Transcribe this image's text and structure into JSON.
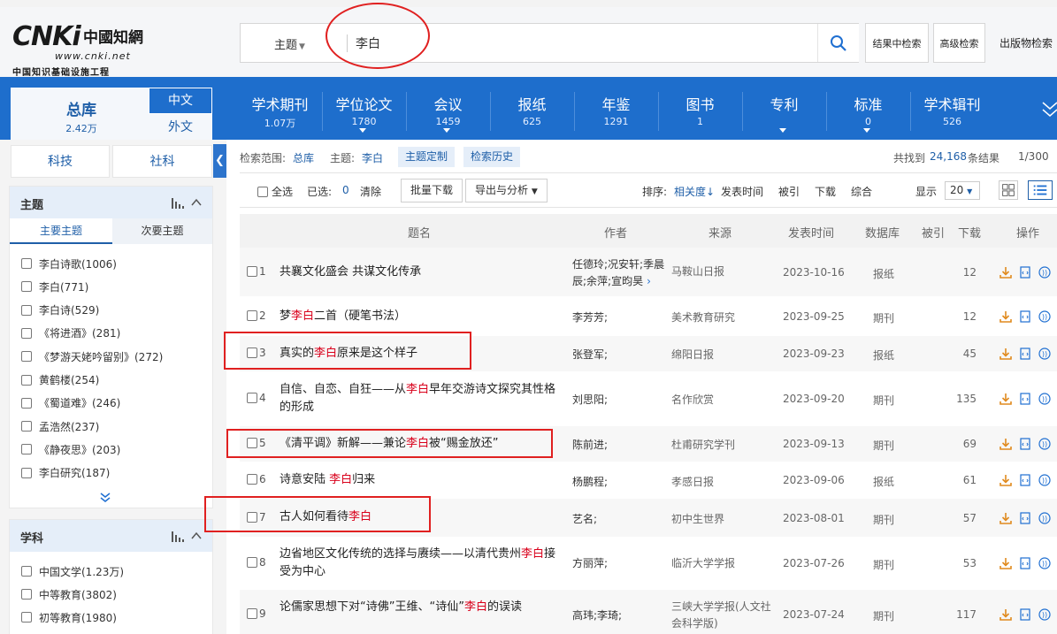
{
  "logo": {
    "main": "CNKi",
    "chinese": "中國知網",
    "url": "www.cnki.net",
    "subtitle": "中国知识基础设施工程"
  },
  "search": {
    "field": "主题",
    "query": "李白",
    "in_results": "结果中检索",
    "advanced": "高级检索",
    "publication": "出版物检索"
  },
  "dbnav": {
    "total_label": "总库",
    "total_count": "2.42万",
    "lang_zh": "中文",
    "lang_en": "外文",
    "categories": [
      {
        "name": "学术期刊",
        "count": "1.07万",
        "caret": false
      },
      {
        "name": "学位论文",
        "count": "1780",
        "caret": true
      },
      {
        "name": "会议",
        "count": "1459",
        "caret": true
      },
      {
        "name": "报纸",
        "count": "625",
        "caret": false
      },
      {
        "name": "年鉴",
        "count": "1291",
        "caret": false
      },
      {
        "name": "图书",
        "count": "1",
        "caret": false
      },
      {
        "name": "专利",
        "count": "",
        "caret": true
      },
      {
        "name": "标准",
        "count": "0",
        "caret": true
      },
      {
        "name": "学术辑刊",
        "count": "526",
        "caret": false
      }
    ]
  },
  "left": {
    "tab_sci": "科技",
    "tab_soc": "社科",
    "topic_panel": {
      "title": "主题",
      "subtab_major": "主要主题",
      "subtab_minor": "次要主题",
      "items": [
        "李白诗歌(1006)",
        "李白(771)",
        "李白诗(529)",
        "《将进酒》(281)",
        "《梦游天姥吟留别》(272)",
        "黄鹤楼(254)",
        "《蜀道难》(246)",
        "孟浩然(237)",
        "《静夜思》(203)",
        "李白研究(187)"
      ]
    },
    "subject_panel": {
      "title": "学科",
      "items": [
        "中国文学(1.23万)",
        "中等教育(3802)",
        "初等教育(1980)"
      ]
    }
  },
  "crumb": {
    "scope_label": "检索范围:",
    "scope_value": "总库",
    "topic_label": "主题:",
    "topic_value": "李白",
    "custom": "主题定制",
    "history": "检索历史",
    "found_prefix": "共找到",
    "found_count": "24,168",
    "found_suffix": "条结果",
    "page": "1/300"
  },
  "toolbar": {
    "select_all": "全选",
    "selected_label": "已选:",
    "selected_count": "0",
    "clear": "清除",
    "batch_download": "批量下载",
    "export": "导出与分析",
    "sort_label": "排序:",
    "sort_relevance": "相关度",
    "sort_date": "发表时间",
    "sort_cited": "被引",
    "sort_download": "下载",
    "sort_composite": "综合",
    "display_label": "显示",
    "page_size": "20"
  },
  "table": {
    "headers": {
      "title": "题名",
      "author": "作者",
      "source": "来源",
      "date": "发表时间",
      "db": "数据库",
      "cite": "被引",
      "download": "下载",
      "ops": "操作"
    },
    "rows": [
      {
        "n": "1",
        "pre": "共襄文化盛会 共谋文化传承",
        "hl": "",
        "post": "",
        "author": "任德玲;况安轩;季晨辰;余萍;宣昀昊",
        "source": "马鞍山日报",
        "date": "2023-10-16",
        "db": "报纸",
        "cite": "",
        "dl": "12"
      },
      {
        "n": "2",
        "pre": "梦",
        "hl": "李白",
        "post": "二首（硬笔书法）",
        "author": "李芳芳;",
        "source": "美术教育研究",
        "date": "2023-09-25",
        "db": "期刊",
        "cite": "",
        "dl": "12"
      },
      {
        "n": "3",
        "pre": "真实的",
        "hl": "李白",
        "post": "原来是这个样子",
        "author": "张登军;",
        "source": "绵阳日报",
        "date": "2023-09-23",
        "db": "报纸",
        "cite": "",
        "dl": "45"
      },
      {
        "n": "4",
        "pre": "自信、自恋、自狂——从",
        "hl": "李白",
        "post": "早年交游诗文探究其性格的形成",
        "author": "刘思阳;",
        "source": "名作欣赏",
        "date": "2023-09-20",
        "db": "期刊",
        "cite": "",
        "dl": "135"
      },
      {
        "n": "5",
        "pre": "《清平调》新解——兼论",
        "hl": "李白",
        "post": "被“赐金放还”",
        "author": "陈前进;",
        "source": "杜甫研究学刊",
        "date": "2023-09-13",
        "db": "期刊",
        "cite": "",
        "dl": "69"
      },
      {
        "n": "6",
        "pre": "诗意安陆 ",
        "hl": "李白",
        "post": "归来",
        "author": "杨鹏程;",
        "source": "孝感日报",
        "date": "2023-09-06",
        "db": "报纸",
        "cite": "",
        "dl": "61"
      },
      {
        "n": "7",
        "pre": "古人如何看待",
        "hl": "李白",
        "post": "",
        "author": "艺名;",
        "source": "初中生世界",
        "date": "2023-08-01",
        "db": "期刊",
        "cite": "",
        "dl": "57"
      },
      {
        "n": "8",
        "pre": "边省地区文化传统的选择与赓续——以清代贵州",
        "hl": "李白",
        "post": "接受为中心",
        "author": "方丽萍;",
        "source": "临沂大学学报",
        "date": "2023-07-26",
        "db": "期刊",
        "cite": "",
        "dl": "53"
      },
      {
        "n": "9",
        "pre": "论儒家思想下对“诗佛”王维、“诗仙”",
        "hl": "李白",
        "post": "的误读",
        "author": "高玮;李琦;",
        "source": "三峡大学学报(人文社会科学版)",
        "date": "2023-07-24",
        "db": "期刊",
        "cite": "",
        "dl": "117"
      }
    ]
  },
  "colors": {
    "brand_blue": "#1e6ecc",
    "highlight_red": "#d9001b",
    "annotation_red": "#e02020",
    "download_orange": "#e08a1e"
  }
}
